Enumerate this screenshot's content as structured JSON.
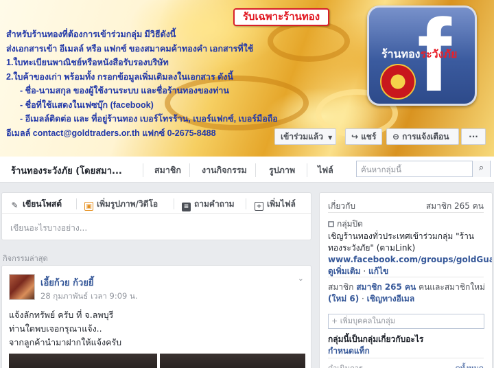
{
  "cover": {
    "badge": "รับเฉพาะร้านทอง",
    "lines": [
      "สำหรับร้านทองที่ต้องการเข้าร่วมกลุ่ม มีวิธีดังนี้",
      "ส่งเอกสารเข้า อีเมลล์ หรือ แฟกซ์ ของสมาคมค้าทองคำ  เอกสารที่ใช้",
      "1.ใบทะเบียนพาณิชย์หรือหนังสือรับรองบริษัท",
      "2.ใบค้าของเก่า พร้อมทั้ง กรอกข้อมูลเพิ่มเติมลงในเอกสาร ดังนี้",
      "- ชื่อ-นามสกุล ของผู้ใช้งานระบบ  และชื่อร้านทองของท่าน",
      "- ชื่อที่ใช้แสดงในเฟซบุ๊ก (facebook)",
      "- อีเมลล์ติดต่อ และ ที่อยู่ร้านทอง  เบอร์โทรร้าน, เบอร์แฟกซ์, เบอร์มือถือ",
      "อีเมลล์ contact@goldtraders.or.th  แฟกซ์ 0-2675-8488"
    ],
    "logo_shop_name_a": "ร้านทอง",
    "logo_shop_name_b": "ระวังภัย",
    "logo_glyph": "f",
    "buttons": {
      "joined": "เข้าร่วมแล้ว",
      "share": "แชร์",
      "notifications": "การแจ้งเตือน",
      "more": "···"
    }
  },
  "nav": {
    "group_name": "ร้านทองระวังภัย (โดยสมา...",
    "items": [
      "สมาชิก",
      "งานกิจกรรม",
      "รูปภาพ",
      "ไฟล์"
    ],
    "search_placeholder": "ค้นหากลุ่มนี้"
  },
  "composer": {
    "tabs": [
      "เขียนโพสต์",
      "เพิ่มรูปภาพ/วิดีโอ",
      "ถามคำถาม",
      "เพิ่มไฟล์"
    ],
    "placeholder": "เขียนอะไรบางอย่าง..."
  },
  "feed": {
    "section_label": "กิจกรรมล่าสุด",
    "post": {
      "author": "เอี้ยก้วย ก้วยยี้",
      "time": "28 กุมภาพันธ์ เวลา 9:09 น.",
      "lines": [
        "แจ้งลักทรัพย์ ครับ ที่ จ.ลพบุรี",
        "ท่านใดพบเจอกรุณาแจ้ง..",
        "จากลูกค้านำมาฝากให้แจ้งครับ"
      ]
    }
  },
  "about": {
    "title": "เกี่ยวกับ",
    "members_count": "สมาชิก 265 คน",
    "privacy": "กลุ่มปิด",
    "desc_text": "เชิญร้านทองทั่วประเทศเข้าร่วมกลุ่ม \"ร้านทองระวังภัย\" (ตามLink)",
    "desc_link": "www.facebook.com/groups/goldGuar...",
    "see_more": "ดูเพิ่มเติม",
    "edit": "แก้ไข",
    "members_label": "สมาชิก",
    "members_link": "สมาชิก 265 คน",
    "members_rest": "คนและสมาชิกใหม่",
    "new_members": "(ใหม่ 6)",
    "invite_email": "เชิญทางอีเมล",
    "add_people_placeholder": "+ เพิ่มบุคคลในกลุ่ม",
    "not_related_text": "กลุ่มนี้เป็นกลุ่มเกี่ยวกับอะไร",
    "set_tags": "กำหนดแท็ก",
    "cut_left": "ดำเนินการ",
    "cut_right": "ดูทั้งหมด"
  },
  "colors": {
    "cover_text": "#2238a8",
    "badge_red": "#e0151f",
    "fb_blue": "#3b5b9f",
    "link": "#365899",
    "page_bg": "#e9ebee"
  }
}
